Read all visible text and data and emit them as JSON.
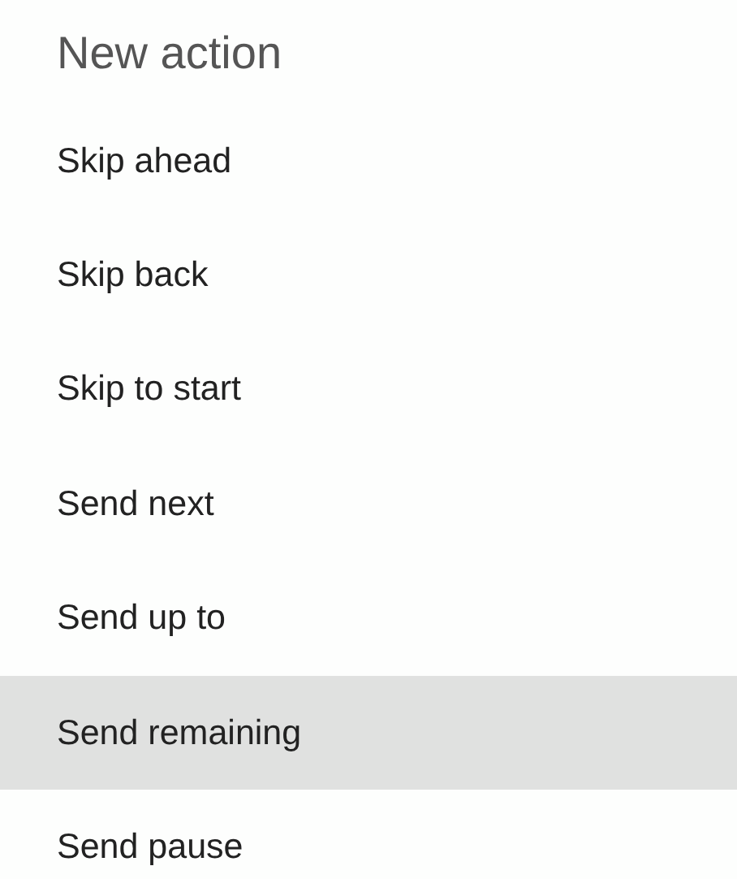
{
  "dialog": {
    "title": "New action",
    "items": [
      {
        "label": "Skip ahead",
        "selected": false
      },
      {
        "label": "Skip back",
        "selected": false
      },
      {
        "label": "Skip to start",
        "selected": false
      },
      {
        "label": "Send next",
        "selected": false
      },
      {
        "label": "Send up to",
        "selected": false
      },
      {
        "label": "Send remaining",
        "selected": true
      },
      {
        "label": "Send pause",
        "selected": false
      }
    ]
  }
}
